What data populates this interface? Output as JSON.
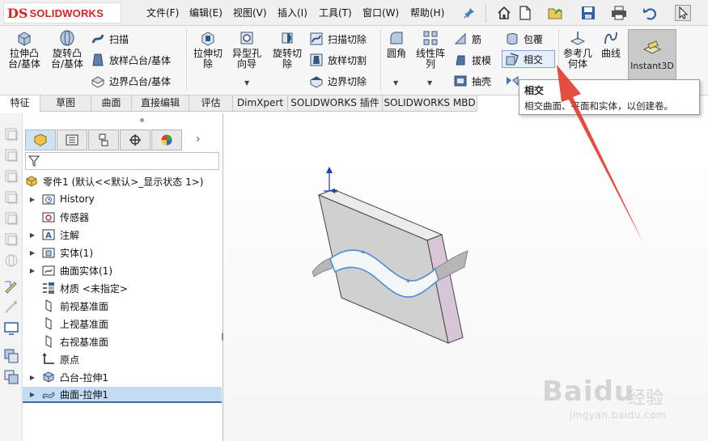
{
  "app": {
    "logo_ds": "DS",
    "logo_name": "SOLIDWORKS"
  },
  "menu": [
    {
      "label": "文件(F)"
    },
    {
      "label": "编辑(E)"
    },
    {
      "label": "视图(V)"
    },
    {
      "label": "插入(I)"
    },
    {
      "label": "工具(T)"
    },
    {
      "label": "窗口(W)"
    },
    {
      "label": "帮助(H)"
    }
  ],
  "ribbon": {
    "extrude_boss": "拉伸凸台/基体",
    "revolve_boss": "旋转凸台/基体",
    "sweep": "扫描",
    "loft_boss": "放样凸台/基体",
    "boundary_boss": "边界凸台/基体",
    "extrude_cut": "拉伸切除",
    "hole_wizard": "异型孔向导",
    "revolve_cut": "旋转切除",
    "swept_cut": "扫描切除",
    "lofted_cut": "放样切割",
    "boundary_cut": "边界切除",
    "fillet": "圆角",
    "linear_pattern": "线性阵列",
    "rib": "筋",
    "draft": "拔模",
    "shell": "抽壳",
    "wrap": "包覆",
    "intersect": "相交",
    "mirror_partial": "镜向",
    "ref_geometry": "参考几何体",
    "curves": "曲线",
    "instant3d": "Instant3D"
  },
  "tabs": [
    {
      "label": "特征",
      "active": true
    },
    {
      "label": "草图"
    },
    {
      "label": "曲面"
    },
    {
      "label": "直接编辑"
    },
    {
      "label": "评估"
    },
    {
      "label": "DimXpert"
    },
    {
      "label": "SOLIDWORKS 插件"
    },
    {
      "label": "SOLIDWORKS MBD"
    }
  ],
  "tooltip": {
    "title": "相交",
    "desc": "相交曲面、平面和实体，以创建卷。"
  },
  "tree": {
    "root": "零件1 (默认<<默认>_显示状态 1>)",
    "items": [
      {
        "label": "History",
        "expandable": true
      },
      {
        "label": "传感器",
        "expandable": false
      },
      {
        "label": "注解",
        "expandable": true
      },
      {
        "label": "实体(1)",
        "expandable": true
      },
      {
        "label": "曲面实体(1)",
        "expandable": true
      },
      {
        "label": "材质 <未指定>",
        "expandable": false
      },
      {
        "label": "前视基准面",
        "expandable": false
      },
      {
        "label": "上视基准面",
        "expandable": false
      },
      {
        "label": "右视基准面",
        "expandable": false
      },
      {
        "label": "原点",
        "expandable": false
      },
      {
        "label": "凸台-拉伸1",
        "expandable": true
      },
      {
        "label": "曲面-拉伸1",
        "expandable": true,
        "selected": true
      }
    ]
  },
  "watermark": {
    "logo": "Baidu",
    "cn": "经验",
    "url": "jingyan.baidu.com"
  },
  "colors": {
    "accent": "#3a6fb0",
    "logo_red": "#d22222",
    "arrow_red": "#e23a2e",
    "model_face_front": "#d0d0d0",
    "model_face_side": "#d8c6d8",
    "surface_blue": "#4a8fd8"
  }
}
